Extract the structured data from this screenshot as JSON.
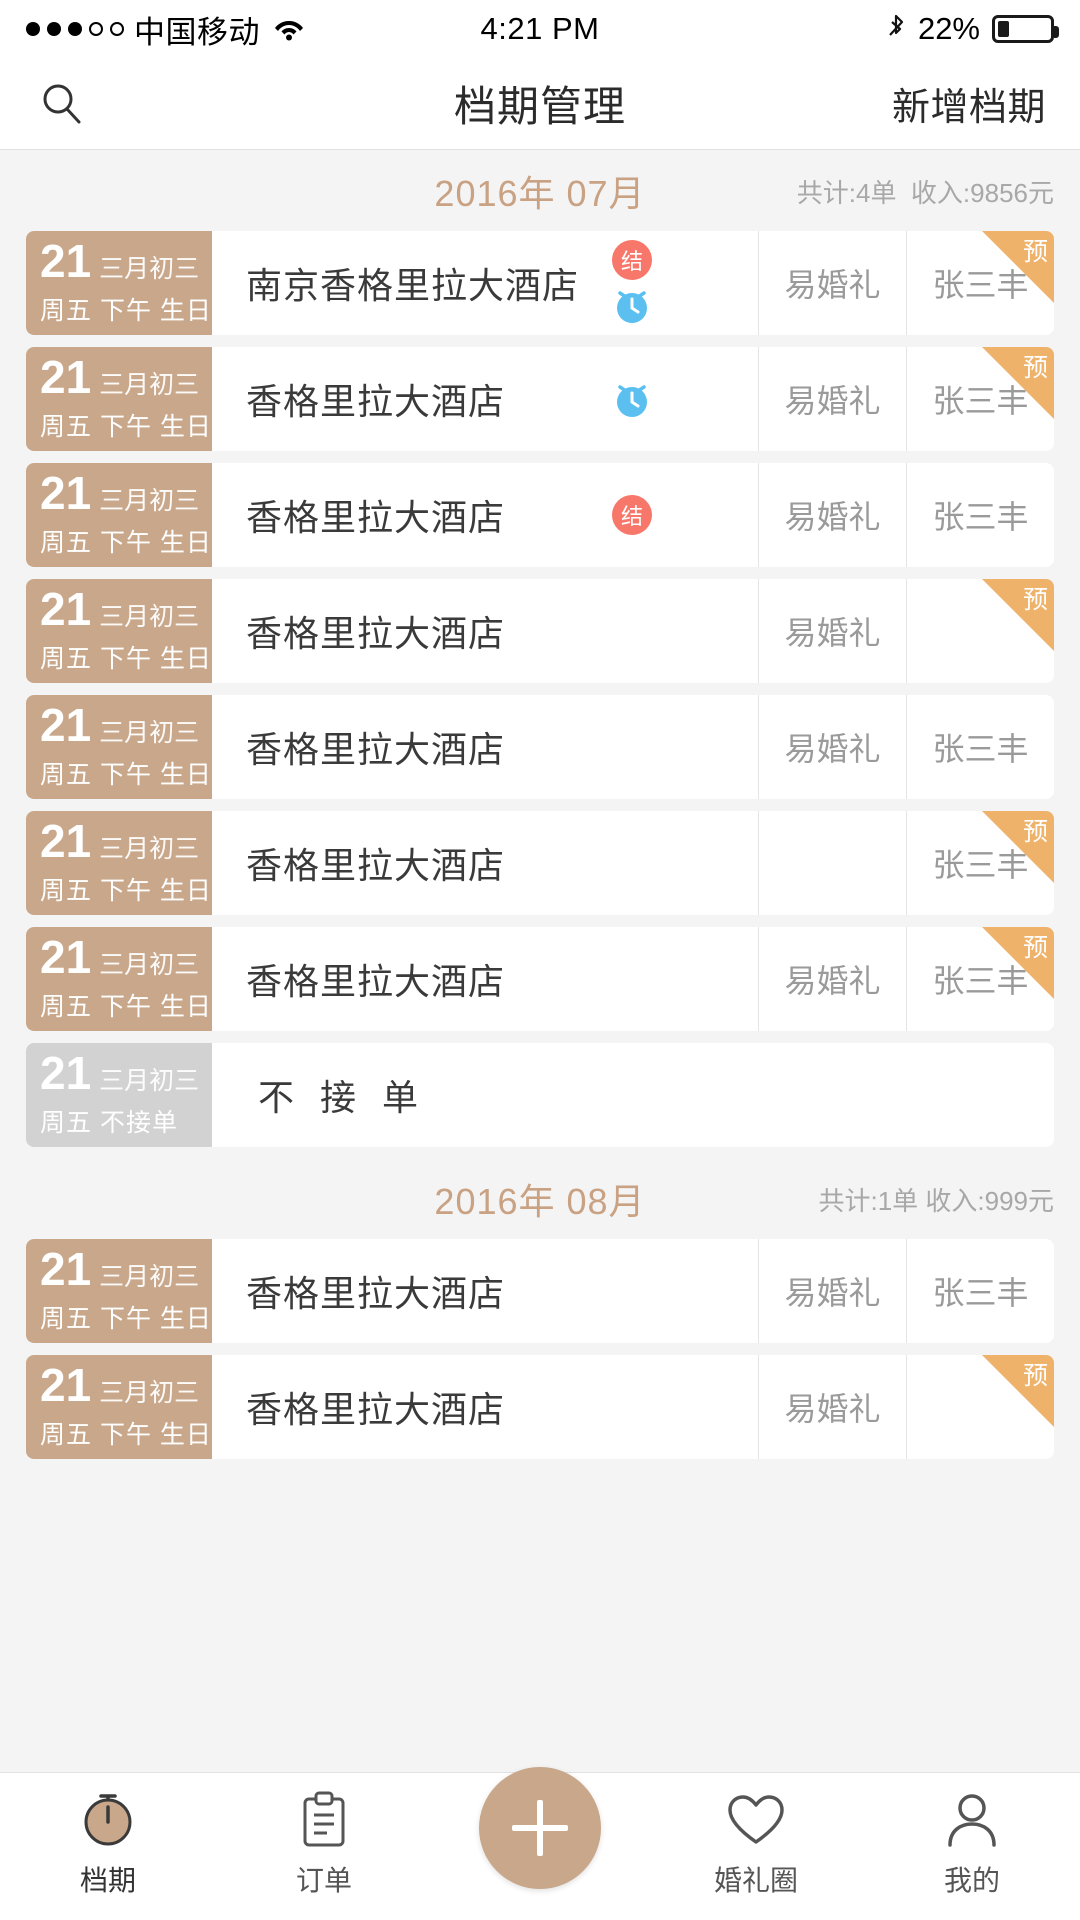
{
  "statusbar": {
    "carrier": "中国移动",
    "time": "4:21 PM",
    "battery_pct": "22%",
    "signal_dots_filled": 3,
    "signal_dots_total": 5,
    "wifi_icon": "wifi-icon",
    "bluetooth_icon": "bluetooth-icon",
    "battery_icon": "battery-icon"
  },
  "navbar": {
    "search_icon": "search-icon",
    "title": "档期管理",
    "action_label": "新增档期"
  },
  "months": [
    {
      "title": "2016年 07月",
      "stats": "共计:4单  收入:9856元",
      "events": [
        {
          "day": "21",
          "lunar": "三月初三",
          "detail": "周五 下午 生日宴",
          "venue": "南京香格里拉大酒店",
          "badge_settled": "结",
          "has_clock": true,
          "company": "易婚礼",
          "person": "张三丰",
          "ribbon": "预",
          "off": false
        },
        {
          "day": "21",
          "lunar": "三月初三",
          "detail": "周五 下午 生日宴",
          "venue": "香格里拉大酒店",
          "badge_settled": "",
          "has_clock": true,
          "company": "易婚礼",
          "person": "张三丰",
          "ribbon": "预",
          "off": false
        },
        {
          "day": "21",
          "lunar": "三月初三",
          "detail": "周五 下午 生日宴",
          "venue": "香格里拉大酒店",
          "badge_settled": "结",
          "has_clock": false,
          "company": "易婚礼",
          "person": "张三丰",
          "ribbon": "",
          "off": false
        },
        {
          "day": "21",
          "lunar": "三月初三",
          "detail": "周五 下午 生日宴",
          "venue": "香格里拉大酒店",
          "badge_settled": "",
          "has_clock": false,
          "company": "易婚礼",
          "person": "",
          "ribbon": "预",
          "off": false
        },
        {
          "day": "21",
          "lunar": "三月初三",
          "detail": "周五 下午 生日宴",
          "venue": "香格里拉大酒店",
          "badge_settled": "",
          "has_clock": false,
          "company": "易婚礼",
          "person": "张三丰",
          "ribbon": "",
          "off": false
        },
        {
          "day": "21",
          "lunar": "三月初三",
          "detail": "周五 下午 生日宴",
          "venue": "香格里拉大酒店",
          "badge_settled": "",
          "has_clock": false,
          "company": "",
          "person": "张三丰",
          "ribbon": "预",
          "off": false
        },
        {
          "day": "21",
          "lunar": "三月初三",
          "detail": "周五 下午 生日宴",
          "venue": "香格里拉大酒店",
          "badge_settled": "",
          "has_clock": false,
          "company": "易婚礼",
          "person": "张三丰",
          "ribbon": "预",
          "off": false
        },
        {
          "day": "21",
          "lunar": "三月初三",
          "detail": "周五   不接单",
          "venue": "不 接 单",
          "badge_settled": "",
          "has_clock": false,
          "company": "",
          "person": "",
          "ribbon": "",
          "off": true
        }
      ]
    },
    {
      "title": "2016年 08月",
      "stats": "共计:1单 收入:999元",
      "events": [
        {
          "day": "21",
          "lunar": "三月初三",
          "detail": "周五 下午 生日宴",
          "venue": "香格里拉大酒店",
          "badge_settled": "",
          "has_clock": false,
          "company": "易婚礼",
          "person": "张三丰",
          "ribbon": "",
          "off": false
        },
        {
          "day": "21",
          "lunar": "三月初三",
          "detail": "周五 下午 生日宴",
          "venue": "香格里拉大酒店",
          "badge_settled": "",
          "has_clock": false,
          "company": "易婚礼",
          "person": "",
          "ribbon": "预",
          "off": false
        }
      ]
    }
  ],
  "tabbar": {
    "items": [
      {
        "label": "档期",
        "icon": "schedule-clock-icon",
        "active": true
      },
      {
        "label": "订单",
        "icon": "clipboard-icon",
        "active": false
      },
      {
        "label": "",
        "icon": "plus-icon",
        "active": false
      },
      {
        "label": "婚礼圈",
        "icon": "heart-icon",
        "active": false
      },
      {
        "label": "我的",
        "icon": "person-icon",
        "active": false
      }
    ]
  },
  "colors": {
    "accent_tan": "#c9a78a",
    "month_title": "#c9a183",
    "ribbon_orange": "#eeb26a",
    "badge_red": "#f7786b",
    "clock_blue": "#5bc0f0",
    "page_bg": "#f4f4f4",
    "off_gray": "#d2d2d2"
  }
}
